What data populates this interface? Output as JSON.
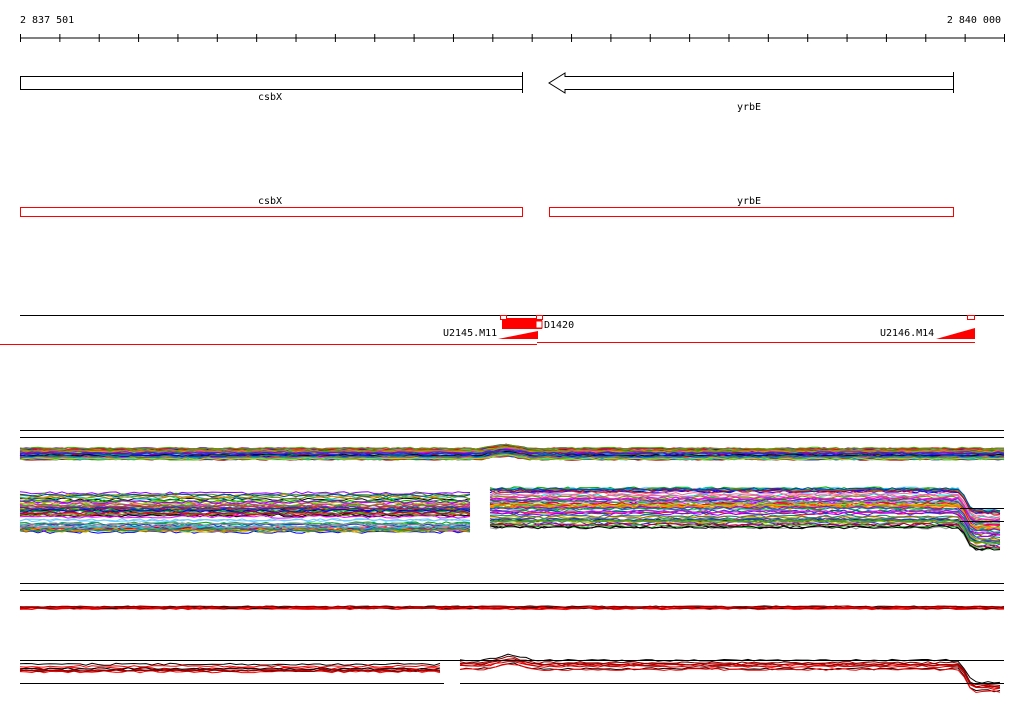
{
  "ruler": {
    "start_label": "2 837 501",
    "end_label": "2 840 000"
  },
  "genes_track": {
    "genes": [
      {
        "name": "csbX",
        "strand": "+"
      },
      {
        "name": "yrbE",
        "strand": "-"
      }
    ]
  },
  "cds_track": {
    "genes": [
      {
        "name": "csbX"
      },
      {
        "name": "yrbE"
      }
    ]
  },
  "features_track": {
    "features": [
      {
        "name": "U2145.M11"
      },
      {
        "name": "D1420"
      },
      {
        "name": "U2146.M14"
      }
    ]
  },
  "colors": {
    "gene_outline": "#000000",
    "cds_outline": "#ff0000",
    "feature_fill": "#ff0000"
  },
  "expression_tracks": {
    "multicolor_series_count": 60,
    "red_black_series_count": 8
  }
}
